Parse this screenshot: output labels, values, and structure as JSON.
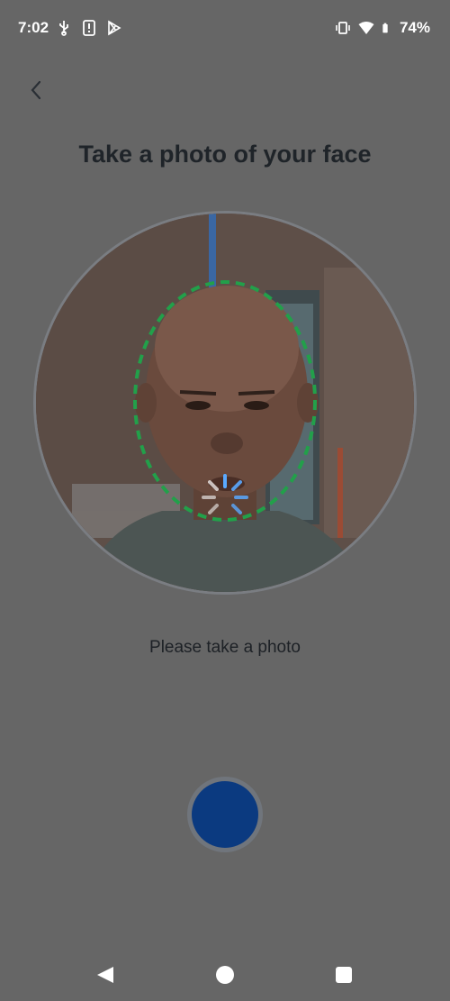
{
  "status_bar": {
    "time": "7:02",
    "left_icons": [
      "usb-icon",
      "sim-alert-icon",
      "play-store-icon"
    ],
    "right_icons": [
      "vibrate-icon",
      "wifi-icon",
      "battery-icon"
    ],
    "battery_percent": "74%"
  },
  "header": {
    "back_icon": "chevron-left-icon",
    "title": "Take a photo of your face"
  },
  "camera": {
    "face_guide_color": "#22a04a",
    "spinner_color": "#5aa9ff"
  },
  "instruction": "Please take a photo",
  "capture_button": {
    "color": "#0b3a80"
  },
  "nav_bar": {
    "buttons": [
      "back-triangle-icon",
      "home-circle-icon",
      "recents-square-icon"
    ]
  }
}
